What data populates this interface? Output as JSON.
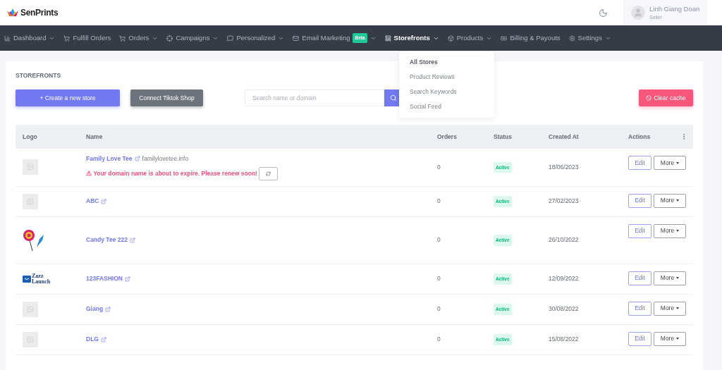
{
  "brand": {
    "name": "SenPrints"
  },
  "user": {
    "name": "Linh Giang Doan",
    "role": "Seller"
  },
  "nav": [
    {
      "label": "Dashboard",
      "dropdown": true,
      "selected": false
    },
    {
      "label": "Fulfill Orders",
      "dropdown": false,
      "selected": false
    },
    {
      "label": "Orders",
      "dropdown": true,
      "selected": false
    },
    {
      "label": "Campaigns",
      "dropdown": true,
      "selected": false
    },
    {
      "label": "Personalized",
      "dropdown": true,
      "selected": false
    },
    {
      "label": "Email Marketing",
      "badge": "Beta",
      "dropdown": true,
      "selected": false
    },
    {
      "label": "Storefronts",
      "dropdown": true,
      "selected": true
    },
    {
      "label": "Products",
      "dropdown": true,
      "selected": false
    },
    {
      "label": "Billing & Payouts",
      "dropdown": false,
      "selected": false
    },
    {
      "label": "Settings",
      "dropdown": true,
      "selected": false
    }
  ],
  "dropdown_menu": [
    {
      "label": "All Stores",
      "selected": true
    },
    {
      "label": "Product Reviews",
      "selected": false
    },
    {
      "label": "Search Keywords",
      "selected": false
    },
    {
      "label": "Social Feed",
      "selected": false
    }
  ],
  "page_title": "STOREFRONTS",
  "buttons": {
    "create": "+ Create a new store",
    "connect": "Connect Tiktok Shop",
    "clear": "Clear cache"
  },
  "search": {
    "placeholder": "Search name or domain"
  },
  "table": {
    "columns": [
      "Logo",
      "Name",
      "Orders",
      "Status",
      "Created At",
      "Actions"
    ],
    "rows": [
      {
        "kind": "placeholder",
        "name": "Family Love Tee",
        "domain": "familylovetee.info",
        "warning": "⚠ Your domain name is about to expire. Please renew soon!",
        "orders": "0",
        "status": "Active",
        "created": "18/06/2023",
        "edit": "Edit",
        "more": "More"
      },
      {
        "kind": "placeholder",
        "name": "ABC",
        "orders": "0",
        "status": "Active",
        "created": "27/02/2023",
        "edit": "Edit",
        "more": "More"
      },
      {
        "kind": "candy",
        "name": "Candy Tee 222",
        "orders": "0",
        "status": "Active",
        "created": "26/10/2022",
        "edit": "Edit",
        "more": "More"
      },
      {
        "kind": "zazz",
        "logo_text": "Zazz Launch",
        "name": "123FASHION",
        "orders": "0",
        "status": "Active",
        "created": "12/09/2022",
        "edit": "Edit",
        "more": "More"
      },
      {
        "kind": "placeholder",
        "name": "Giang",
        "orders": "0",
        "status": "Active",
        "created": "30/08/2022",
        "edit": "Edit",
        "more": "More"
      },
      {
        "kind": "placeholder",
        "name": "DLG",
        "orders": "0",
        "status": "Active",
        "created": "15/08/2022",
        "edit": "Edit",
        "more": "More"
      }
    ]
  }
}
